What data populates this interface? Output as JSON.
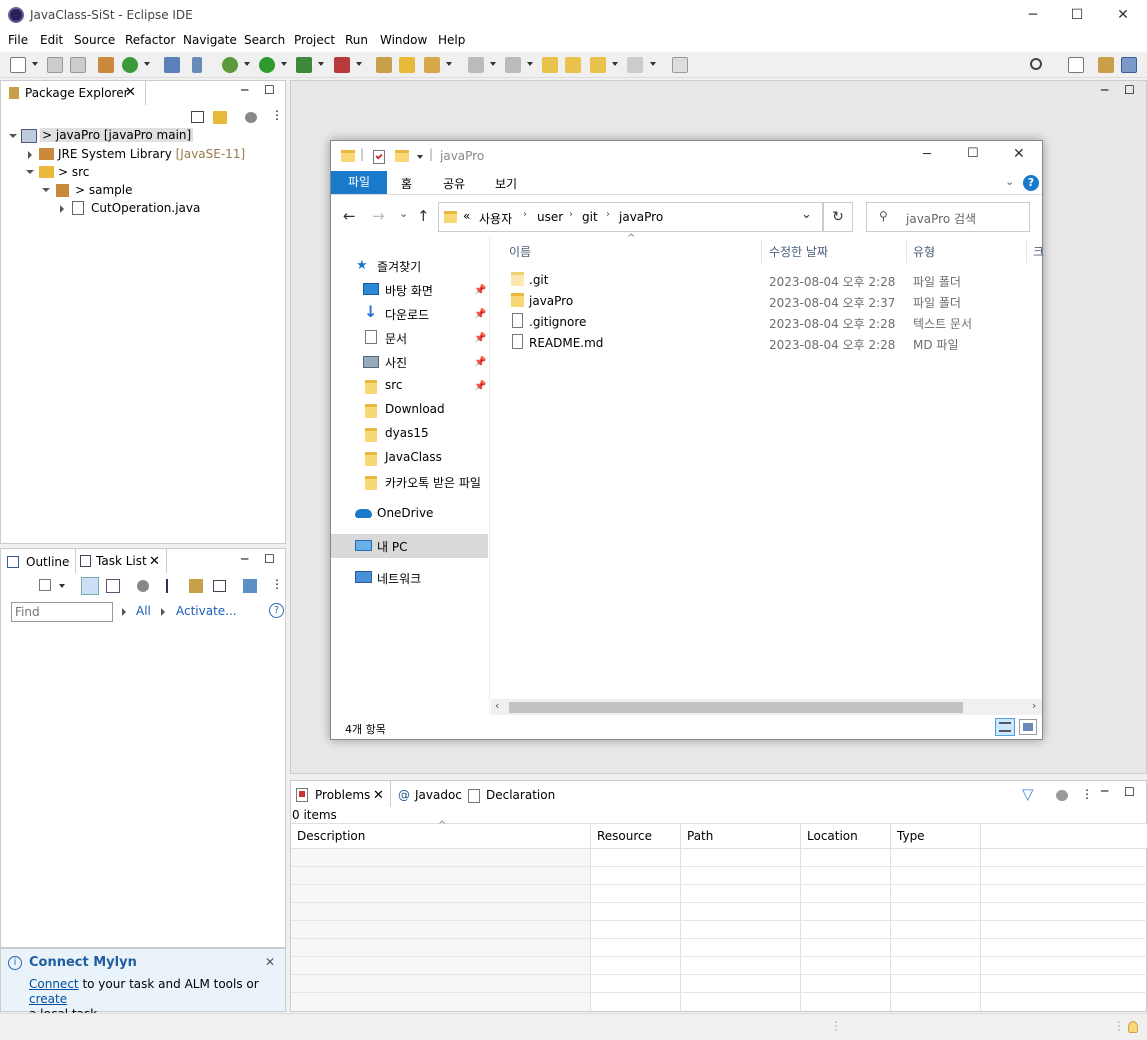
{
  "window": {
    "title": "JavaClass-SiSt - Eclipse IDE",
    "minimize": "─",
    "maximize": "☐",
    "close": "✕"
  },
  "menu": [
    "File",
    "Edit",
    "Source",
    "Refactor",
    "Navigate",
    "Search",
    "Project",
    "Run",
    "Window",
    "Help"
  ],
  "package_explorer": {
    "tab": "Package Explorer",
    "tree": [
      {
        "label": "> javaPro [javaPro main]"
      },
      {
        "label": "JRE System Library",
        "suffix": "[JavaSE-11]"
      },
      {
        "label": "> src"
      },
      {
        "label": "> sample"
      },
      {
        "label": "CutOperation.java"
      }
    ]
  },
  "outline": {
    "tab_outline": "Outline",
    "tab_tasklist": "Task List",
    "find_placeholder": "Find",
    "all": "All",
    "activate": "Activate..."
  },
  "mylyn": {
    "title": "Connect Mylyn",
    "connect": "Connect",
    "text1": " to your task and ALM tools or ",
    "create": "create",
    "text2": "a local task."
  },
  "explorer": {
    "title": "javaPro",
    "ribbon_tabs": [
      "파일",
      "홈",
      "공유",
      "보기"
    ],
    "breadcrumb": {
      "chev": "«",
      "parts": [
        "사용자",
        "user",
        "git",
        "javaPro"
      ]
    },
    "search_placeholder": "javaPro 검색",
    "nav": {
      "quick_access": "즐겨찾기",
      "items": [
        "바탕 화면",
        "다운로드",
        "문서",
        "사진",
        "src",
        "Download",
        "dyas15",
        "JavaClass",
        "카카오톡 받은 파일"
      ],
      "onedrive": "OneDrive",
      "mypc": "내 PC",
      "network": "네트워크"
    },
    "columns": {
      "name": "이름",
      "date": "수정한 날짜",
      "type": "유형",
      "more": "크"
    },
    "files": [
      {
        "name": ".git",
        "date": "2023-08-04 오후 2:28",
        "type": "파일 폴더"
      },
      {
        "name": "javaPro",
        "date": "2023-08-04 오후 2:37",
        "type": "파일 폴더"
      },
      {
        "name": ".gitignore",
        "date": "2023-08-04 오후 2:28",
        "type": "텍스트 문서"
      },
      {
        "name": "README.md",
        "date": "2023-08-04 오후 2:28",
        "type": "MD 파일"
      }
    ],
    "status": "4개 항목"
  },
  "problems": {
    "tab_problems": "Problems",
    "tab_javadoc": "Javadoc",
    "tab_declaration": "Declaration",
    "count": "0 items",
    "columns": [
      "Description",
      "Resource",
      "Path",
      "Location",
      "Type"
    ]
  },
  "colors": {
    "accent": "#1979ca",
    "selection": "#cce8ff",
    "folder": "#f8d775"
  }
}
